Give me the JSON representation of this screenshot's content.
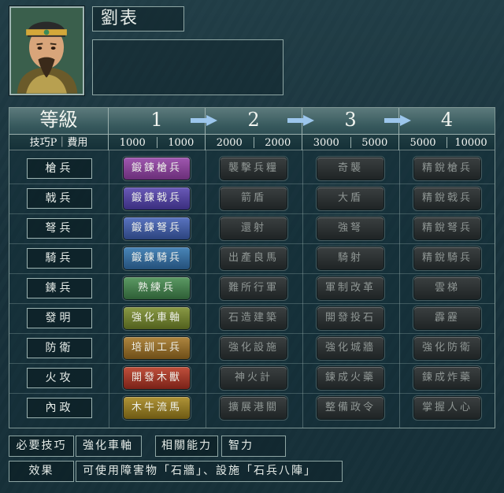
{
  "officer": {
    "name": "劉表",
    "description": ""
  },
  "header": {
    "rank_label": "等級",
    "cost_label": "技巧P｜費用",
    "tiers": [
      {
        "level": "1",
        "tech": "1000",
        "cost": "1000"
      },
      {
        "level": "2",
        "tech": "2000",
        "cost": "2000"
      },
      {
        "level": "3",
        "tech": "3000",
        "cost": "5000"
      },
      {
        "level": "4",
        "tech": "5000",
        "cost": "10000"
      }
    ]
  },
  "rows": [
    {
      "category": "槍兵",
      "skills": [
        "鍛鍊槍兵",
        "襲擊兵糧",
        "奇襲",
        "精銳槍兵"
      ],
      "color": "#7a3a86"
    },
    {
      "category": "戟兵",
      "skills": [
        "鍛鍊戟兵",
        "箭盾",
        "大盾",
        "精銳戟兵"
      ],
      "color": "#4a3f8e"
    },
    {
      "category": "弩兵",
      "skills": [
        "鍛鍊弩兵",
        "還射",
        "強弩",
        "精銳弩兵"
      ],
      "color": "#36508f"
    },
    {
      "category": "騎兵",
      "skills": [
        "鍛鍊騎兵",
        "出產良馬",
        "騎射",
        "精銳騎兵"
      ],
      "color": "#2f5e8e"
    },
    {
      "category": "鍊兵",
      "skills": [
        "熟練兵",
        "難所行軍",
        "軍制改革",
        "雲梯"
      ],
      "color": "#3f7a4a"
    },
    {
      "category": "發明",
      "skills": [
        "強化車軸",
        "石造建築",
        "開發投石",
        "霹靂"
      ],
      "color": "#6a7a32"
    },
    {
      "category": "防衛",
      "skills": [
        "培訓工兵",
        "強化設施",
        "強化城牆",
        "強化防衛"
      ],
      "color": "#8a6a2c"
    },
    {
      "category": "火攻",
      "skills": [
        "開發木獸",
        "神火計",
        "鍊成火藥",
        "鍊成炸藥"
      ],
      "color": "#9a3528"
    },
    {
      "category": "內政",
      "skills": [
        "木牛流馬",
        "擴展港關",
        "整備政令",
        "掌握人心"
      ],
      "color": "#8a7226"
    }
  ],
  "footer": {
    "required_label": "必要技巧",
    "required_value": "強化車軸",
    "related_label": "相關能力",
    "related_value": "智力",
    "effect_label": "效果",
    "effect_value": "可使用障害物「石牆」、設施「石兵八陣」"
  },
  "colors": {
    "arrow": "#9cc6ec",
    "locked_text": "#8f9694"
  }
}
